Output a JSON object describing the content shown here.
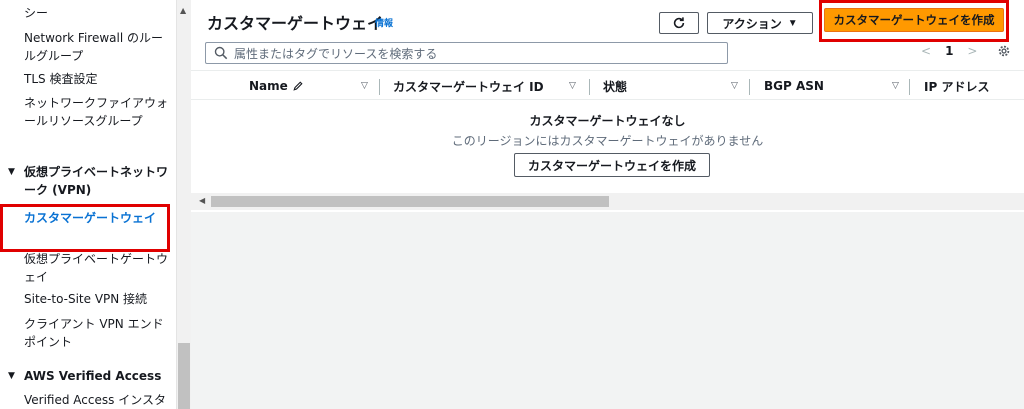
{
  "sidebar": {
    "items": [
      {
        "label": "シー"
      },
      {
        "label": "Network Firewall のルールグループ"
      },
      {
        "label": "TLS 検査設定"
      },
      {
        "label": "ネットワークファイアウォールリソースグループ"
      },
      {
        "label": "カスタマーゲートウェイ"
      },
      {
        "label": "仮想プライベートゲートウェイ"
      },
      {
        "label": "Site-to-Site VPN 接続"
      },
      {
        "label": "クライアント VPN エンドポイント"
      },
      {
        "label": "Verified Access インスタ"
      }
    ],
    "sections": [
      {
        "label": "仮想プライベートネットワーク (VPN)"
      },
      {
        "label": "AWS Verified Access"
      }
    ]
  },
  "header": {
    "title": "カスタマーゲートウェイ",
    "info": "情報",
    "actions_label": "アクション",
    "create_label": "カスタマーゲートウェイを作成"
  },
  "search": {
    "placeholder": "属性またはタグでリソースを検索する"
  },
  "pagination": {
    "prev": "<",
    "page": "1",
    "next": ">"
  },
  "table": {
    "columns": [
      {
        "label": "Name"
      },
      {
        "label": "カスタマーゲートウェイ ID"
      },
      {
        "label": "状態"
      },
      {
        "label": "BGP ASN"
      },
      {
        "label": "IP アドレス"
      }
    ]
  },
  "empty_state": {
    "title": "カスタマーゲートウェイなし",
    "description": "このリージョンにはカスタマーゲートウェイがありません",
    "button_label": "カスタマーゲートウェイを作成"
  },
  "colors": {
    "primary": "#ff9900",
    "highlight": "#e00000",
    "link": "#0972d3"
  }
}
